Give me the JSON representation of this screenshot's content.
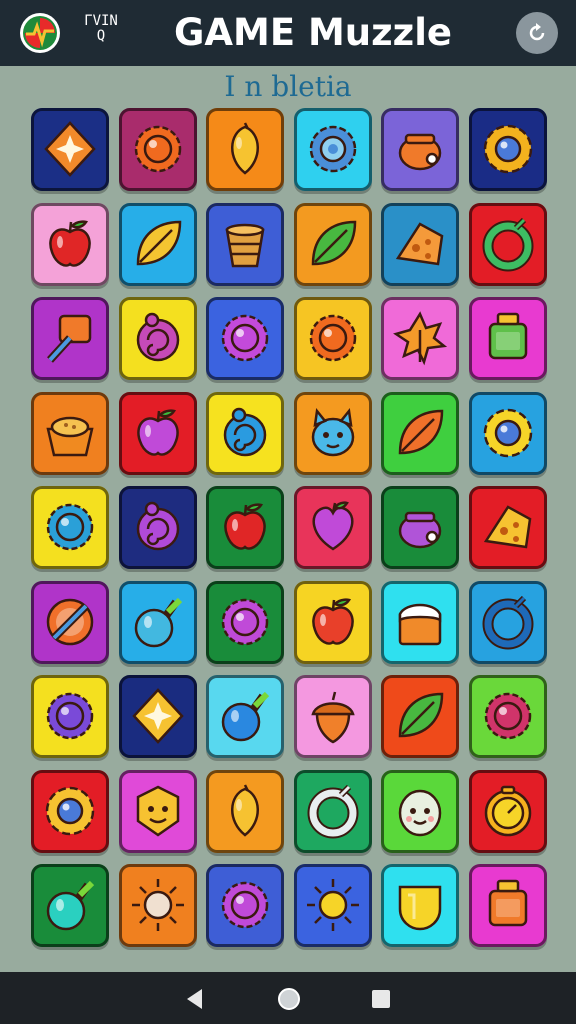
{
  "header": {
    "label_line1": "ΓVIN",
    "label_line2": "Q",
    "title": "GAME Muzzle"
  },
  "subtitle": "I n bletia",
  "colors": {
    "header_bg": "#1f2b34",
    "board_bg": "#98ab9e",
    "subtitle": "#1e6a93",
    "navbar_bg": "#1e2226"
  },
  "grid": {
    "rows": 9,
    "cols": 6,
    "tiles": [
      {
        "bg": "#1b2f86",
        "icon": "star-gem-icon",
        "color": "#f28a2a"
      },
      {
        "bg": "#a92c6c",
        "icon": "gear-ball-icon",
        "color": "#f06a1f"
      },
      {
        "bg": "#f58a18",
        "icon": "lemon-icon",
        "color": "#f6c330"
      },
      {
        "bg": "#2fd0ef",
        "icon": "gear-icon",
        "color": "#4a8fd8"
      },
      {
        "bg": "#7b64d8",
        "icon": "pot-icon",
        "color": "#f07a2a"
      },
      {
        "bg": "#1a2c86",
        "icon": "sun-gem-icon",
        "color": "#f3b21e"
      },
      {
        "bg": "#f4a2d8",
        "icon": "apple-icon",
        "color": "#e02626"
      },
      {
        "bg": "#27aee8",
        "icon": "leaf-icon",
        "color": "#f4c431"
      },
      {
        "bg": "#3e5ed6",
        "icon": "bucket-icon",
        "color": "#e1a040"
      },
      {
        "bg": "#f39a20",
        "icon": "leaf-icon",
        "color": "#48b840"
      },
      {
        "bg": "#2a90c8",
        "icon": "cheese-icon",
        "color": "#f49a3a"
      },
      {
        "bg": "#e31d26",
        "icon": "ring-icon",
        "color": "#3dbd63"
      },
      {
        "bg": "#b034c9",
        "icon": "hammer-icon",
        "color": "#f07a2a"
      },
      {
        "bg": "#f4e01f",
        "icon": "swirl-icon",
        "color": "#c64ab8"
      },
      {
        "bg": "#3b63e0",
        "icon": "gear-ball-icon",
        "color": "#c34adb"
      },
      {
        "bg": "#f6c523",
        "icon": "gear-ball-icon",
        "color": "#f06a1f"
      },
      {
        "bg": "#f06ad8",
        "icon": "maple-leaf-icon",
        "color": "#f39a2a"
      },
      {
        "bg": "#e83ad0",
        "icon": "jar-icon",
        "color": "#5fc04a"
      },
      {
        "bg": "#f0801f",
        "icon": "bowl-icon",
        "color": "#f6c250"
      },
      {
        "bg": "#e31d26",
        "icon": "apple-icon",
        "color": "#c04ad8"
      },
      {
        "bg": "#f6e21f",
        "icon": "swirl-icon",
        "color": "#2a9be0"
      },
      {
        "bg": "#f49a20",
        "icon": "creature-icon",
        "color": "#4ab8e8"
      },
      {
        "bg": "#3fcf3f",
        "icon": "leaf-icon",
        "color": "#f0702a"
      },
      {
        "bg": "#27a2e0",
        "icon": "sun-gem-icon",
        "color": "#f6d428"
      },
      {
        "bg": "#f4e01f",
        "icon": "gear-ball-icon",
        "color": "#2aa0d8"
      },
      {
        "bg": "#1e2c80",
        "icon": "swirl-icon",
        "color": "#b04ad8"
      },
      {
        "bg": "#198c3a",
        "icon": "apple-icon",
        "color": "#e02626"
      },
      {
        "bg": "#e8345a",
        "icon": "heart-icon",
        "color": "#c04ad8"
      },
      {
        "bg": "#198c3a",
        "icon": "pot-icon",
        "color": "#b054d8"
      },
      {
        "bg": "#e31d26",
        "icon": "cheese-icon",
        "color": "#f6c231"
      },
      {
        "bg": "#b034c9",
        "icon": "no-entry-icon",
        "color": "#f0702a"
      },
      {
        "bg": "#27aee8",
        "icon": "bomb-icon",
        "color": "#42b8e0"
      },
      {
        "bg": "#198c3a",
        "icon": "gear-ball-icon",
        "color": "#c04ad8"
      },
      {
        "bg": "#f6d423",
        "icon": "apple-icon",
        "color": "#e8402a"
      },
      {
        "bg": "#2fe0ef",
        "icon": "cake-icon",
        "color": "#f08a2a"
      },
      {
        "bg": "#27a2e0",
        "icon": "ring-icon",
        "color": "#1e6ab8"
      },
      {
        "bg": "#f4e01f",
        "icon": "gear-ball-icon",
        "color": "#7a4ad8"
      },
      {
        "bg": "#1a2c80",
        "icon": "star-gem-icon",
        "color": "#f6c231"
      },
      {
        "bg": "#58d8ef",
        "icon": "bomb-icon",
        "color": "#2a88e0"
      },
      {
        "bg": "#f498e0",
        "icon": "acorn-icon",
        "color": "#f0802a"
      },
      {
        "bg": "#ef4a1a",
        "icon": "leaf-icon",
        "color": "#48b840"
      },
      {
        "bg": "#6ad83a",
        "icon": "gear-ball-icon",
        "color": "#d0346a"
      },
      {
        "bg": "#e31d26",
        "icon": "sun-gem-icon",
        "color": "#f6c231"
      },
      {
        "bg": "#e04ad8",
        "icon": "face-icon",
        "color": "#f6c231"
      },
      {
        "bg": "#f49a20",
        "icon": "lemon-icon",
        "color": "#f6c231"
      },
      {
        "bg": "#1ea860",
        "icon": "ring-icon",
        "color": "#e8eef0"
      },
      {
        "bg": "#5ad83a",
        "icon": "egg-face-icon",
        "color": "#e8f0e0"
      },
      {
        "bg": "#e31d26",
        "icon": "clock-icon",
        "color": "#f6b21e"
      },
      {
        "bg": "#198c3a",
        "icon": "bomb-icon",
        "color": "#2ad0c0"
      },
      {
        "bg": "#f0801f",
        "icon": "sun-icon",
        "color": "#f0e0d0"
      },
      {
        "bg": "#3e5ed6",
        "icon": "gear-ball-icon",
        "color": "#c04ad8"
      },
      {
        "bg": "#3b63e0",
        "icon": "sun-icon",
        "color": "#f6d428"
      },
      {
        "bg": "#2fe0ef",
        "icon": "shield-icon",
        "color": "#f6d428"
      },
      {
        "bg": "#e83ad0",
        "icon": "jar-icon",
        "color": "#f07a2a"
      }
    ]
  },
  "navbar": {
    "back": "back-icon",
    "home": "home-icon",
    "recents": "recents-icon"
  }
}
